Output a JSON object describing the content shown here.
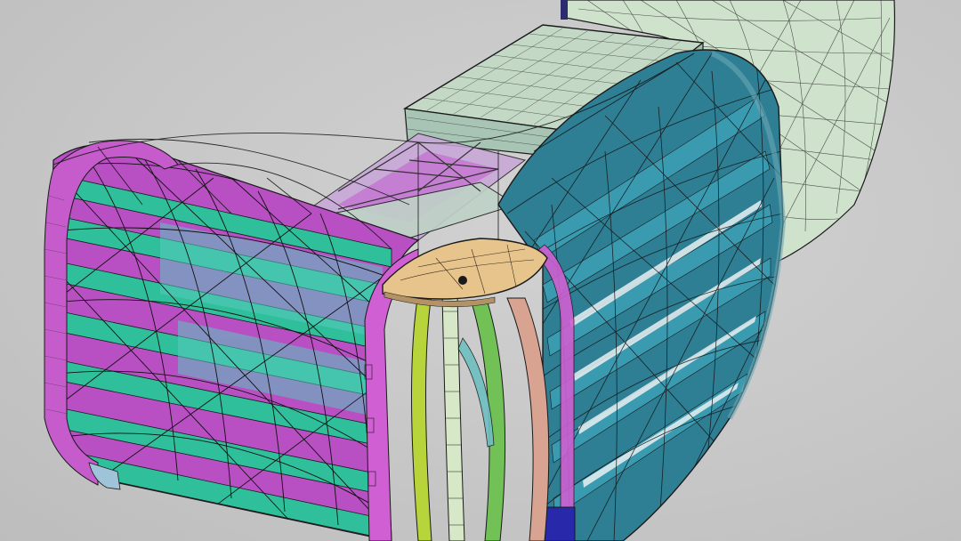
{
  "viewport": {
    "background_color": "#c8c8c8"
  },
  "scene": {
    "description_colors": {
      "rear_fairing_fill": "#cfe3cc",
      "upper_deck_fill": "#bfd9c8",
      "right_barrel_fill": "#2f7f95",
      "left_stringer_fill": "#2fbf9a",
      "frame_fill": "#c23fc6",
      "hatch_fill": "#e5c48c",
      "rib_yellow": "#b9d43a",
      "rib_green": "#6fbf55",
      "rib_salmon": "#d7a391",
      "bottom_block": "#2525a8",
      "wire_color": "#1a1a1a"
    }
  }
}
